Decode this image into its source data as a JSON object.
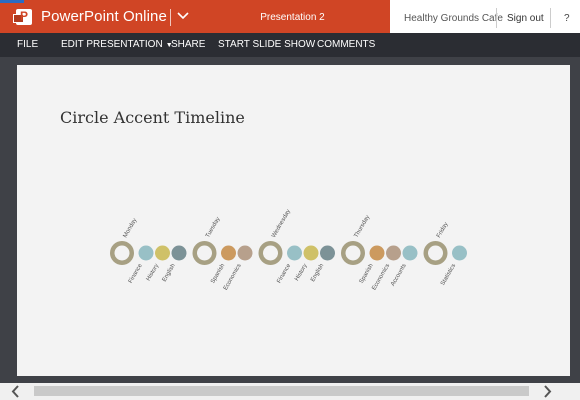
{
  "app": {
    "name": "PowerPoint Online",
    "document_title": "Presentation 2",
    "company": "Healthy Grounds Cafe",
    "signout_label": "Sign out",
    "help_label": "?",
    "brand_color": "#d04525"
  },
  "menu": {
    "file": "FILE",
    "edit_presentation": "EDIT PRESENTATION",
    "share": "SHARE",
    "start_slide_show": "START SLIDE SHOW",
    "comments": "COMMENTS"
  },
  "slide": {
    "title": "Circle Accent Timeline",
    "days": [
      {
        "label": "Monday",
        "subjects": [
          "Finance",
          "History",
          "English"
        ]
      },
      {
        "label": "Tuesday",
        "subjects": [
          "Spanish",
          "Economics"
        ]
      },
      {
        "label": "Wednesday",
        "subjects": [
          "Finance",
          "History",
          "English"
        ]
      },
      {
        "label": "Thursday",
        "subjects": [
          "Spanish",
          "Economics",
          "Accounts"
        ]
      },
      {
        "label": "Friday",
        "subjects": [
          "Statistics"
        ]
      }
    ],
    "colors": {
      "day_ring": "#a7a083",
      "subjects": [
        "#98c0c6",
        "#cfc168",
        "#7c9297",
        "#cc9a5f",
        "#b7a08c",
        "#98c0c6"
      ]
    }
  },
  "icons": {
    "app_logo": "powerpoint-logo-icon",
    "chevron": "chevron-down-icon",
    "scroll_left": "chevron-left-icon",
    "scroll_right": "chevron-right-icon"
  }
}
